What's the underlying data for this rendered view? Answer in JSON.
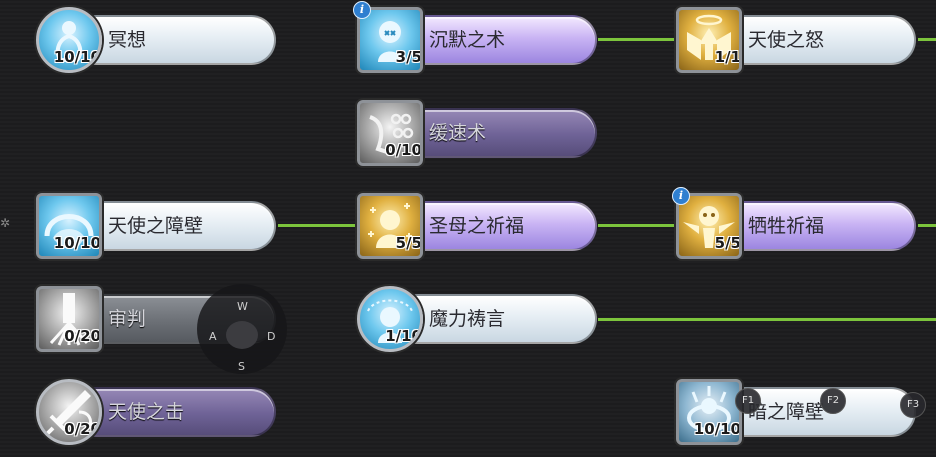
{
  "skills": {
    "meditation": {
      "name": "冥想",
      "level": "10/10"
    },
    "silence": {
      "name": "沉默之术",
      "level": "3/5"
    },
    "angel_wrath": {
      "name": "天使之怒",
      "level": "1/1"
    },
    "slow": {
      "name": "缓速术",
      "level": "0/10"
    },
    "angel_barrier": {
      "name": "天使之障壁",
      "level": "10/10"
    },
    "madonna_prayer": {
      "name": "圣母之祈福",
      "level": "5/5"
    },
    "sacrifice_blessing": {
      "name": "牺牲祈福",
      "level": "5/5"
    },
    "judgement": {
      "name": "审判",
      "level": "0/20"
    },
    "magic_prayer": {
      "name": "魔力祷言",
      "level": "1/10"
    },
    "angel_strike": {
      "name": "天使之击",
      "level": "0/20"
    },
    "dark_barrier": {
      "name": "暗之障壁",
      "level": "10/10"
    }
  },
  "info_badge": "i",
  "joystick": {
    "up": "W",
    "left": "A",
    "right": "D",
    "down": "S"
  },
  "hotkeys": {
    "f1": "F1",
    "f2": "F2",
    "f3": "F3"
  },
  "colors": {
    "link": "#7cc43c",
    "background": "#1e1e20"
  }
}
